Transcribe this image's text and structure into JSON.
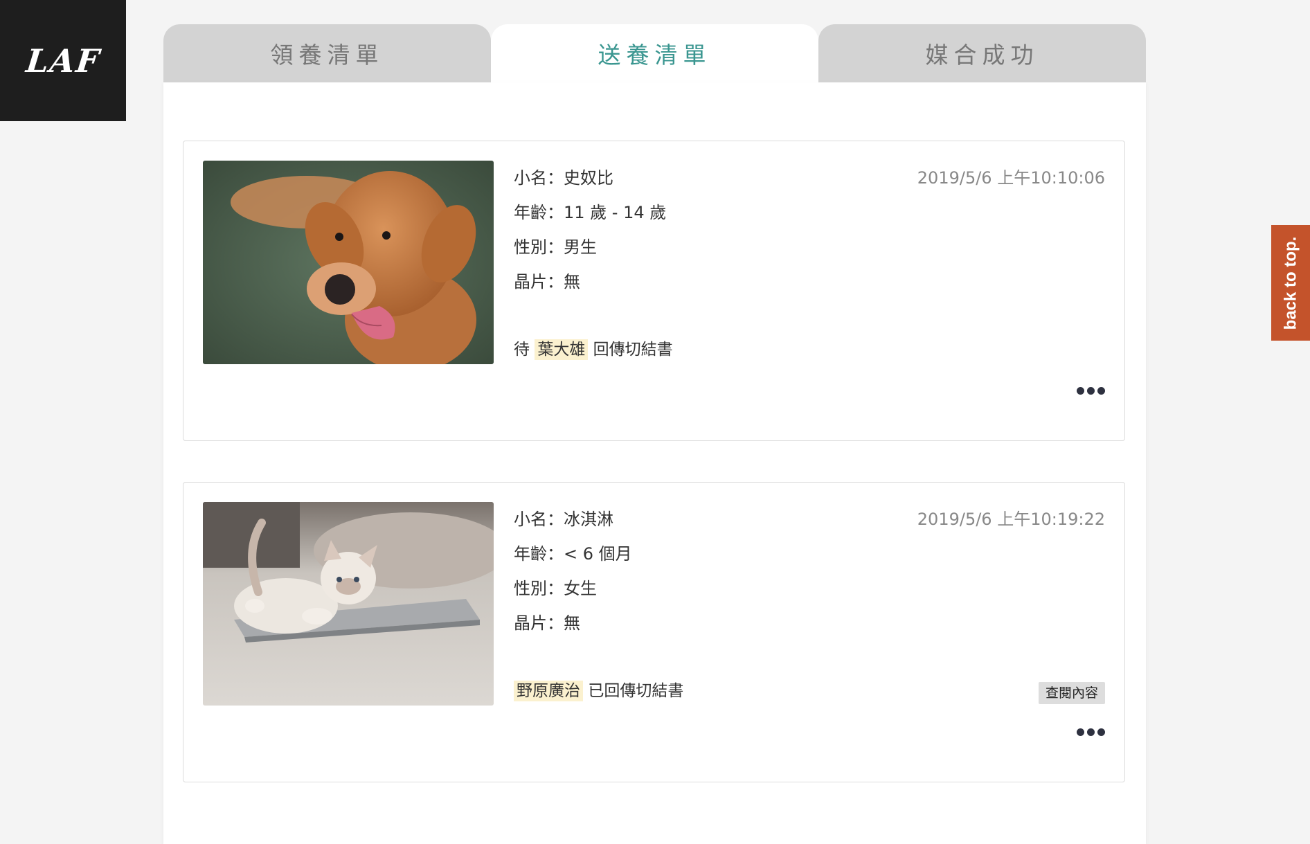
{
  "logo": {
    "text": "LAF"
  },
  "tabs": [
    {
      "label": "領養清單",
      "active": false
    },
    {
      "label": "送養清單",
      "active": true
    },
    {
      "label": "媒合成功",
      "active": false
    }
  ],
  "accent_color": "#3a9690",
  "back_to_top": {
    "label": "back to top."
  },
  "cards": [
    {
      "image": "golden-retriever-photo",
      "name": "小名：史奴比",
      "age": "年齡：11 歲 - 14 歲",
      "gender": "性別：男生",
      "chip": "晶片：無",
      "timestamp": "2019/5/6 上午10:10:06",
      "status_prefix": "待",
      "status_person": "葉大雄",
      "status_suffix": "回傳切結書",
      "more_icon": "more-dots-icon"
    },
    {
      "image": "white-kitten-photo",
      "name": "小名：冰淇淋",
      "age": "年齡：< 6 個月",
      "gender": "性別：女生",
      "chip": "晶片：無",
      "timestamp": "2019/5/6 上午10:19:22",
      "status_person": "野原廣治",
      "status_suffix": "已回傳切結書",
      "view_label": "查閱內容",
      "more_icon": "more-dots-icon"
    }
  ]
}
